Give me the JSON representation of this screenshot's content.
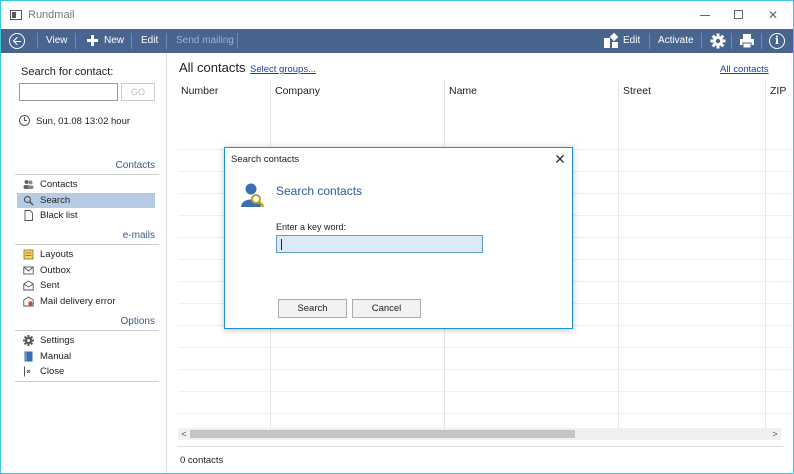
{
  "window": {
    "title": "Rundmail",
    "minimize_glyph": "—",
    "maximize_glyph": "☐",
    "close_glyph": "✕"
  },
  "toolbar": {
    "view_label": "View",
    "new_label": "New",
    "edit_label": "Edit",
    "send_mailing_label": "Send mailing",
    "edit_right_label": "Edit",
    "activate_label": "Activate",
    "info_glyph": "i"
  },
  "sidebar": {
    "search_label": "Search for contact:",
    "search_value": "",
    "go_label": "GO",
    "datetime": "Sun, 01.08   13:02 hour",
    "sections": {
      "contacts": "Contacts",
      "emails": "e-mails",
      "options": "Options"
    },
    "contacts_items": [
      {
        "label": "Contacts",
        "icon": "people-icon"
      },
      {
        "label": "Search",
        "icon": "magnifier-icon"
      },
      {
        "label": "Black list",
        "icon": "document-icon"
      }
    ],
    "email_items": [
      {
        "label": "Layouts",
        "icon": "layout-icon"
      },
      {
        "label": "Outbox",
        "icon": "outbox-icon"
      },
      {
        "label": "Sent",
        "icon": "sent-icon"
      },
      {
        "label": "Mail delivery error",
        "icon": "error-mail-icon"
      }
    ],
    "option_items": [
      {
        "label": "Settings",
        "icon": "gear-icon"
      },
      {
        "label": "Manual",
        "icon": "book-icon"
      },
      {
        "label": "Close",
        "icon": "exit-icon"
      }
    ]
  },
  "main": {
    "title": "All contacts",
    "select_groups_link": "Select groups...",
    "all_contacts_link": "All contacts",
    "columns": [
      "Number",
      "Company",
      "Name",
      "Street",
      "ZIP"
    ],
    "status": "0 contacts",
    "scroll_left_glyph": "<",
    "scroll_right_glyph": ">"
  },
  "dialog": {
    "title": "Search contacts",
    "close_glyph": "✕",
    "heading": "Search contacts",
    "label": "Enter a key word:",
    "value": "",
    "search_button": "Search",
    "cancel_button": "Cancel"
  },
  "colors": {
    "toolbar_bg": "#4a6490",
    "accent": "#3b5a8c",
    "active_item": "#b8cbe4",
    "dialog_border": "#1e90d0",
    "link": "#1a3fa8"
  }
}
